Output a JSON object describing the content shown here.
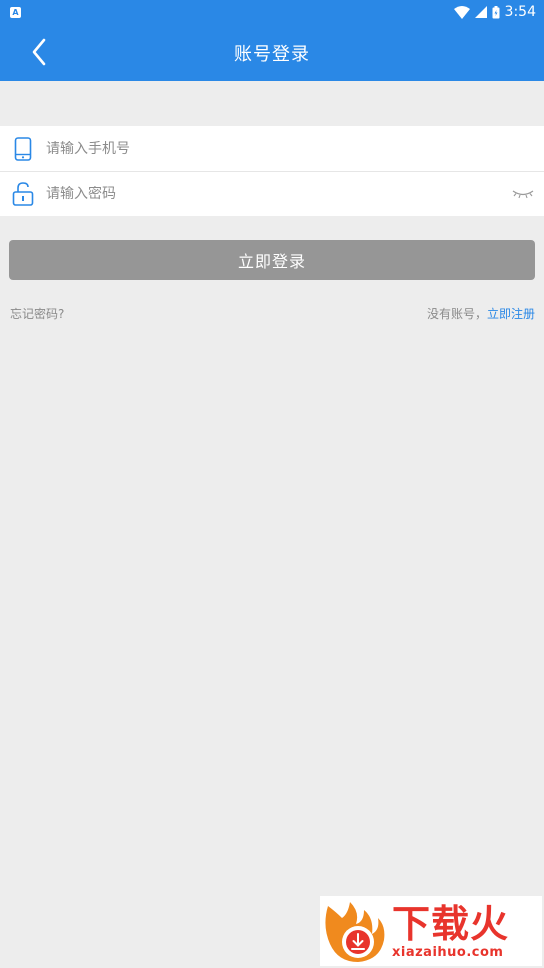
{
  "status_bar": {
    "notification_icon_letter": "A",
    "time": "3:54"
  },
  "app_bar": {
    "title": "账号登录"
  },
  "form": {
    "phone": {
      "placeholder": "请输入手机号",
      "value": ""
    },
    "password": {
      "placeholder": "请输入密码",
      "value": ""
    }
  },
  "login_button": {
    "label": "立即登录"
  },
  "links": {
    "forgot_password": "忘记密码?",
    "no_account_text": "没有账号，",
    "register": "立即注册"
  },
  "watermark": {
    "cn": "下载火",
    "en": "xiazaihuo.com"
  },
  "colors": {
    "primary": "#2a88e6",
    "button_disabled": "#969696",
    "background": "#ededed",
    "watermark": "#e8342c"
  },
  "icons": {
    "back": "chevron-left-icon",
    "phone": "phone-icon",
    "lock": "unlock-icon",
    "eye": "eye-closed-icon",
    "wifi": "wifi-icon",
    "signal": "signal-icon",
    "battery": "battery-icon"
  }
}
